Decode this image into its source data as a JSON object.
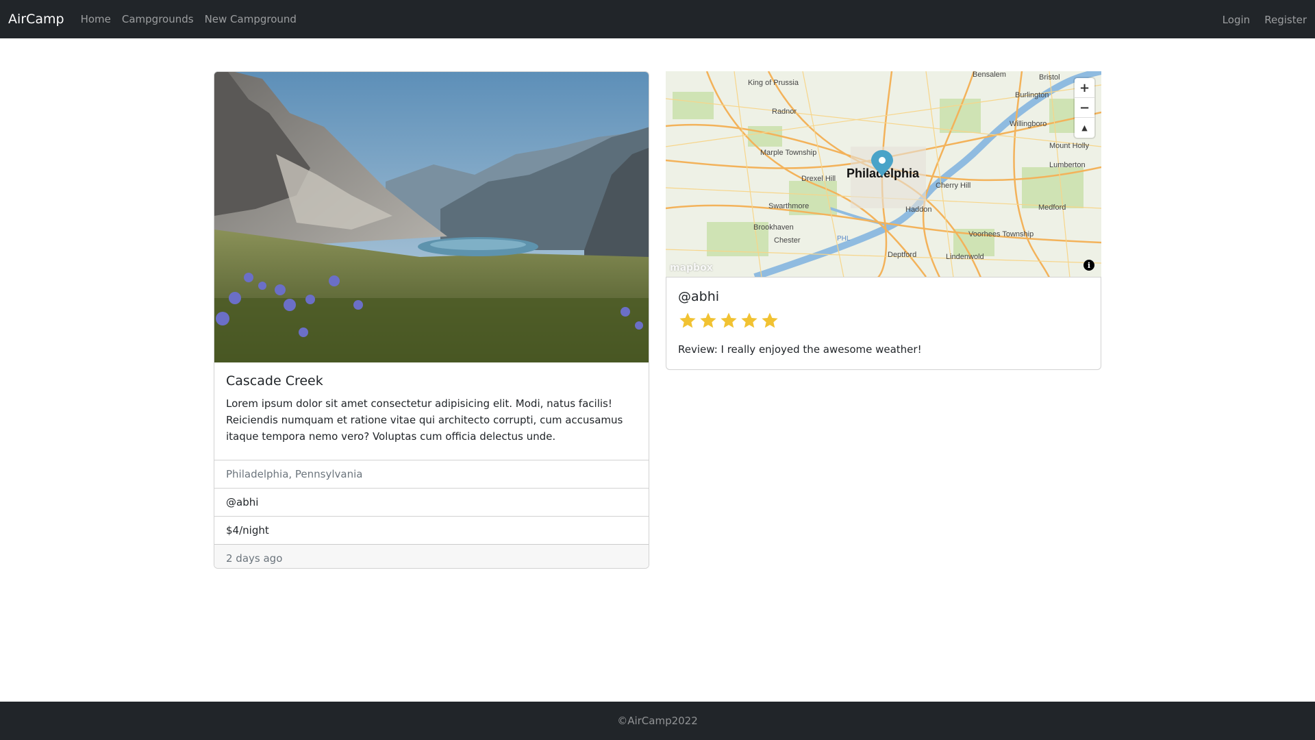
{
  "nav": {
    "brand": "AirCamp",
    "links": [
      "Home",
      "Campgrounds",
      "New Campground"
    ],
    "right_links": [
      "Login",
      "Register"
    ]
  },
  "campground": {
    "title": "Cascade Creek",
    "description": "Lorem ipsum dolor sit amet consectetur adipisicing elit. Modi, natus facilis! Reiciendis numquam et ratione vitae qui architecto corrupti, cum accusamus itaque tempora nemo vero? Voluptas cum officia delectus unde.",
    "location": "Philadelphia, Pennsylvania",
    "author": "@abhi",
    "price": "$4/night",
    "created": "2 days ago"
  },
  "map": {
    "labels": {
      "center": "Philadelphia",
      "king_of_prussia": "King of Prussia",
      "radnor": "Radnor",
      "marple": "Marple Township",
      "drexel": "Drexel Hill",
      "swarthmore": "Swarthmore",
      "brookhaven": "Brookhaven",
      "chester": "Chester",
      "bensalem": "Bensalem",
      "bristol": "Bristol",
      "burlington": "Burlington",
      "willingboro": "Willingboro",
      "mount_holly": "Mount Holly",
      "lumberton": "Lumberton",
      "cherry_hill": "Cherry Hill",
      "haddon": "Haddon",
      "medford": "Medford",
      "voorhees": "Voorhees Township",
      "deptford": "Deptford",
      "lindenwold": "Lindenwold",
      "phl": "PHL"
    },
    "controls": {
      "zoom_in": "+",
      "zoom_out": "−",
      "compass": "▲"
    },
    "attribution_logo": "mapbox",
    "info_icon": "i"
  },
  "review": {
    "author": "@abhi",
    "rating": 5,
    "rating_max": 5,
    "text": "Review: I really enjoyed the awesome weather!",
    "star_color": "#f1c232"
  },
  "footer": {
    "copyright": "©AirCamp2022"
  }
}
